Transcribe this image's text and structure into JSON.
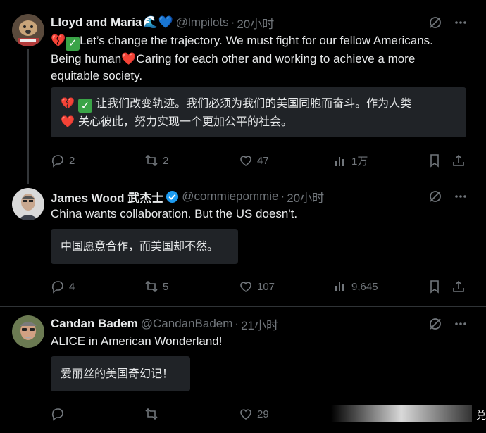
{
  "tweets": [
    {
      "name": "Lloyd and Maria",
      "name_emoji": "🌊💙",
      "handle": "@lmpilots",
      "separator": "·",
      "time": "20小时",
      "text_parts": [
        "💔",
        "✅",
        "Let’s change the trajectory. We must fight for our fellow Americans. Being human",
        "❤️",
        "Caring for each other and working to achieve a more equitable society."
      ],
      "translation_parts": [
        "💔",
        "✅",
        " 让我们改变轨迹。我们必须为我们的美国同胞而奋斗。作为人类",
        "❤️",
        " 关心彼此，努力实现一个更加公平的社会。"
      ],
      "replies": "2",
      "reposts": "2",
      "likes": "47",
      "views": "1万"
    },
    {
      "name": "James Wood 武杰士",
      "handle": "@commiepommie",
      "separator": "·",
      "time": "20小时",
      "text": "China wants collaboration. But the US doesn't.",
      "translation": "中国愿意合作，而美国却不然。",
      "replies": "4",
      "reposts": "5",
      "likes": "107",
      "views": "9,645"
    },
    {
      "name": "Candan Badem",
      "handle": "@CandanBadem",
      "separator": "·",
      "time": "21小时",
      "text": "ALICE in American Wonderland!",
      "translation": "爱丽丝的美国奇幻记！",
      "replies": "",
      "reposts": "",
      "likes": "29",
      "views": ""
    }
  ],
  "watermark": "兑",
  "colors": {
    "background": "#000000",
    "text": "#e7e9ea",
    "muted": "#71767b",
    "verified": "#1d9bf0",
    "translation_bg": "#202327"
  }
}
